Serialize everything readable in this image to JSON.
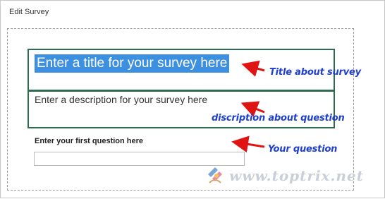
{
  "window": {
    "title": "Edit Survey"
  },
  "survey": {
    "title_placeholder": "Enter a title for your survey here",
    "description_placeholder": "Enter a description for your survey here",
    "question_label": "Enter your first question here",
    "question_value": ""
  },
  "annotations": {
    "title_note": "Title about survey",
    "description_note": "discription about question",
    "question_note": "Your question"
  },
  "watermark": {
    "text": "www.toptrix.net"
  },
  "colors": {
    "selection_bg": "#3d8fe0",
    "box_border": "#2f6b4f",
    "arrow": "#e11414",
    "annotation_text": "#1f3fd0"
  },
  "icons": {
    "arrow": "red-arrow-icon",
    "logo": "toptrix-logo-icon"
  }
}
